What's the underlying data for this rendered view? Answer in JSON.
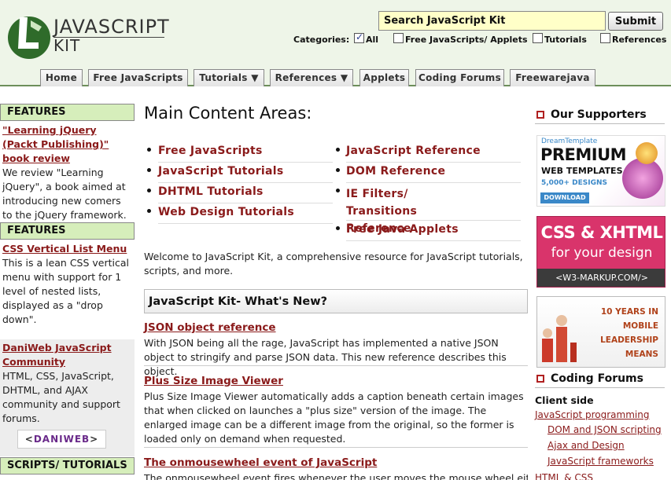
{
  "header": {
    "logo_title": "JAVASCRIPT",
    "logo_sub": "KIT",
    "search_value": "Search JavaScript Kit",
    "search_button": "Submit",
    "categories_label": "Categories:",
    "categories": [
      {
        "label": "All",
        "checked": true
      },
      {
        "label": "Free JavaScripts/ Applets",
        "checked": false
      },
      {
        "label": "Tutorials",
        "checked": false
      },
      {
        "label": "References",
        "checked": false
      }
    ]
  },
  "nav": {
    "tabs": [
      {
        "label": "Home"
      },
      {
        "label": "Free JavaScripts"
      },
      {
        "label": "Tutorials ▼"
      },
      {
        "label": "References ▼"
      },
      {
        "label": "Applets"
      },
      {
        "label": "Coding Forums"
      },
      {
        "label": "Freewarejava"
      }
    ]
  },
  "left": {
    "features1": {
      "heading": "FEATURES",
      "link": "\"Learning jQuery (Packt Publishing)\" book review",
      "text": "We review \"Learning jQuery\", a book aimed at introducing new comers to the jQuery framework."
    },
    "features2": {
      "heading": "FEATURES",
      "link": "CSS Vertical List Menu",
      "text": "This is a lean CSS vertical menu with support for 1 level of nested lists, displayed as a \"drop down\"."
    },
    "daniweb": {
      "link": "DaniWeb JavaScript Community",
      "text": "HTML, CSS, JavaScript, DHTML, and AJAX community and support forums.",
      "logo_text": "DANIWEB"
    },
    "scripts_heading": "SCRIPTS/ TUTORIALS"
  },
  "main": {
    "title": "Main Content Areas:",
    "areas_left": [
      "Free JavaScripts",
      "JavaScript Tutorials",
      "DHTML Tutorials",
      "Web Design Tutorials"
    ],
    "areas_right": [
      "JavaScript Reference",
      "DOM Reference",
      "IE Filters/ Transitions Reference",
      "Free Java Applets"
    ],
    "welcome": "Welcome to JavaScript Kit, a comprehensive resource for JavaScript tutorials, scripts, and more.",
    "whats_new": "JavaScript Kit- What's New?",
    "news": [
      {
        "title": "JSON object reference",
        "text": "With JSON being all the rage, JavaScript has implemented a native JSON object to stringify and parse JSON data. This new reference describes this object."
      },
      {
        "title": "Plus Size Image Viewer",
        "text": "Plus Size Image Viewer automatically adds a caption beneath certain images that when clicked on launches a \"plus size\" version of the image. The enlarged image can be a different image from the original, so the former is loaded only on demand when requested."
      },
      {
        "title": "The onmousewheel event of JavaScript",
        "text": "The onmousewheel event fires whenever the user moves the mouse wheel either"
      }
    ]
  },
  "right": {
    "supporters_heading": "Our Supporters",
    "ads": [
      {
        "brand": "DreamTemplate",
        "title": "PREMIUM",
        "sub": "WEB TEMPLATES",
        "count": "5,000+ DESIGNS",
        "cta": "DOWNLOAD"
      },
      {
        "title": "CSS & XHTML",
        "sub": "for your design",
        "footer": "<W3-MARKUP.COM/>"
      },
      {
        "text": "10 YEARS IN MOBILE LEADERSHIP MEANS"
      }
    ],
    "forums_heading": "Coding Forums",
    "forums_subheading": "Client side",
    "forums_links": [
      "JavaScript programming",
      "DOM and JSON scripting",
      "Ajax and Design",
      "JavaScript frameworks"
    ],
    "forums_next": "HTML & CSS"
  },
  "colors": {
    "link": "#8a1a1a",
    "feature_head_bg": "#d6eebb",
    "header_bg": "#eef5e8",
    "search_bg": "#ffffc8"
  }
}
